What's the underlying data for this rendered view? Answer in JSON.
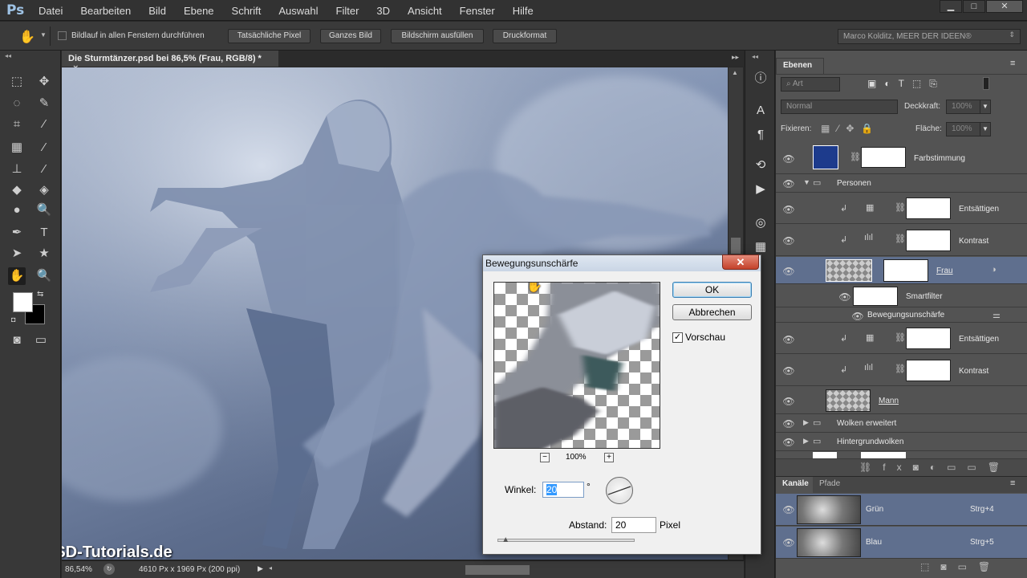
{
  "app": {
    "logo": "Ps"
  },
  "menu": [
    "Datei",
    "Bearbeiten",
    "Bild",
    "Ebene",
    "Schrift",
    "Auswahl",
    "Filter",
    "3D",
    "Ansicht",
    "Fenster",
    "Hilfe"
  ],
  "window_controls": {
    "minimize": "▁",
    "maximize": "□",
    "close": "✕"
  },
  "options": {
    "scroll_all_label": "Bildlauf in allen Fenstern durchführen",
    "buttons": [
      "Tatsächliche Pixel",
      "Ganzes Bild",
      "Bildschirm ausfüllen",
      "Druckformat"
    ],
    "workspace": "Marco Kolditz, MEER DER IDEEN®"
  },
  "document": {
    "tab_title": "Die Sturmtänzer.psd bei 86,5% (Frau, RGB/8) *",
    "zoom": "86,54%",
    "info": "4610 Px x 1969 Px (200 ppi)",
    "watermark": "PSD-Tutorials.de"
  },
  "layers_panel": {
    "tab": "Ebenen",
    "filter_kind": "Art",
    "blend_mode": "Normal",
    "opacity_label": "Deckkraft:",
    "opacity_value": "100%",
    "lock_label": "Fixieren:",
    "fill_label": "Fläche:",
    "fill_value": "100%",
    "layers": [
      {
        "name": "Farbstimmung",
        "type": "fill"
      },
      {
        "name": "Personen",
        "type": "group-open"
      },
      {
        "name": "Entsättigen",
        "type": "adjust-hsl"
      },
      {
        "name": "Kontrast",
        "type": "adjust-curves"
      },
      {
        "name": "Frau",
        "type": "smart",
        "selected": true
      },
      {
        "name": "Smartfilter",
        "type": "smartfilter"
      },
      {
        "name": "Bewegungsunschärfe",
        "type": "filter"
      },
      {
        "name": "Entsättigen",
        "type": "adjust-hsl"
      },
      {
        "name": "Kontrast",
        "type": "adjust-curves"
      },
      {
        "name": "Mann",
        "type": "smart"
      },
      {
        "name": "Wolken erweitert",
        "type": "group"
      },
      {
        "name": "Hintergrundwolken",
        "type": "group"
      }
    ]
  },
  "channels_panel": {
    "tabs": [
      "Kanäle",
      "Pfade"
    ],
    "channels": [
      {
        "name": "Grün",
        "shortcut": "Strg+4"
      },
      {
        "name": "Blau",
        "shortcut": "Strg+5"
      }
    ]
  },
  "dialog": {
    "title": "Bewegungsunschärfe",
    "ok": "OK",
    "cancel": "Abbrechen",
    "preview_label": "Vorschau",
    "preview_checked": true,
    "zoom": "100%",
    "zoom_out": "−",
    "zoom_in": "+",
    "angle_label": "Winkel:",
    "angle_value": "20",
    "angle_unit": "°",
    "distance_label": "Abstand:",
    "distance_value": "20",
    "distance_unit": "Pixel",
    "distance_slider_fraction": 0.06
  },
  "colors": {
    "accent_selection": "#5f6f8e",
    "foreground": "#ffffff",
    "background": "#000000",
    "farbstimmung": "#1d3b8c"
  }
}
